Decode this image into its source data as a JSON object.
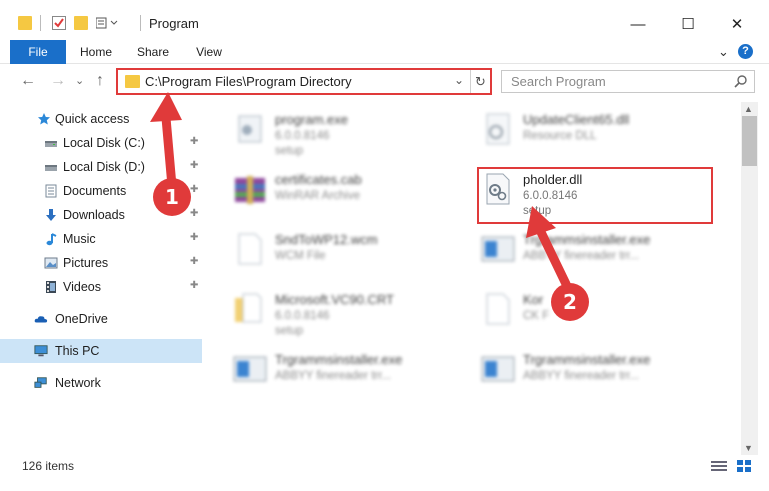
{
  "window": {
    "title": "Program",
    "minimize": "—",
    "maximize": "☐",
    "close": "✕"
  },
  "ribbon": {
    "tabs": [
      "File",
      "Home",
      "Share",
      "View"
    ],
    "expand": "⌄",
    "help": "?"
  },
  "nav": {
    "back": "←",
    "forward": "→",
    "recent": "⌄",
    "up": "↑",
    "address": "C:\\Program Files\\Program Directory",
    "address_chevron": "⌄",
    "refresh": "↻",
    "search_placeholder": "Search Program"
  },
  "sidebar": {
    "items": [
      {
        "label": "Quick access",
        "icon": "star-icon",
        "pinned": false
      },
      {
        "label": "Local Disk (C:)",
        "icon": "drive-icon",
        "pinned": true
      },
      {
        "label": "Local Disk (D:)",
        "icon": "drive-icon",
        "pinned": true
      },
      {
        "label": "Documents",
        "icon": "documents-icon",
        "pinned": true
      },
      {
        "label": "Downloads",
        "icon": "download-icon",
        "pinned": true
      },
      {
        "label": "Music",
        "icon": "music-icon",
        "pinned": true
      },
      {
        "label": "Pictures",
        "icon": "pictures-icon",
        "pinned": true
      },
      {
        "label": "Videos",
        "icon": "videos-icon",
        "pinned": true
      },
      {
        "label": "OneDrive",
        "icon": "cloud-icon",
        "pinned": false
      },
      {
        "label": "This PC",
        "icon": "computer-icon",
        "pinned": false
      },
      {
        "label": "Network",
        "icon": "network-icon",
        "pinned": false
      }
    ],
    "pin_glyph": "📌"
  },
  "files": [
    {
      "name": "program.exe",
      "sub1": "6.0.0.8146",
      "sub2": "setup",
      "icon": "exe-icon"
    },
    {
      "name": "UpdateClient65.dll",
      "sub1": "Resource DLL",
      "sub2": "",
      "icon": "dll-icon"
    },
    {
      "name": "certificates.cab",
      "sub1": "WinRAR Archive",
      "sub2": "",
      "icon": "archive-icon"
    },
    {
      "name": "pholder.dll",
      "sub1": "6.0.0.8146",
      "sub2": "setup",
      "icon": "dll-gear-icon"
    },
    {
      "name": "SndToWP12.wcm",
      "sub1": "WCM File",
      "sub2": "",
      "icon": "file-icon"
    },
    {
      "name": "Trgrammsinstaller.exe",
      "sub1": "ABBYY finereader trr...",
      "sub2": "",
      "icon": "installer-icon"
    },
    {
      "name": "Microsoft.VC90.CRT",
      "sub1": "6.0.0.8146",
      "sub2": "setup",
      "icon": "folder-file-icon"
    },
    {
      "name": "Kor",
      "sub1": "CK F",
      "sub2": "",
      "icon": "file-icon"
    },
    {
      "name": "Trgrammsinstaller.exe",
      "sub1": "ABBYY finereader trr...",
      "sub2": "",
      "icon": "installer-icon"
    },
    {
      "name": "Trgrammsinstaller.exe",
      "sub1": "ABBYY finereader trr...",
      "sub2": "",
      "icon": "installer-icon"
    }
  ],
  "annotations": {
    "badge1": "1",
    "badge2": "2",
    "color": "#e03a3a"
  },
  "status": {
    "count": "126 items"
  },
  "colors": {
    "accent": "#1a6fc9",
    "selected": "#cce4f7",
    "highlight": "#e03a3a"
  }
}
